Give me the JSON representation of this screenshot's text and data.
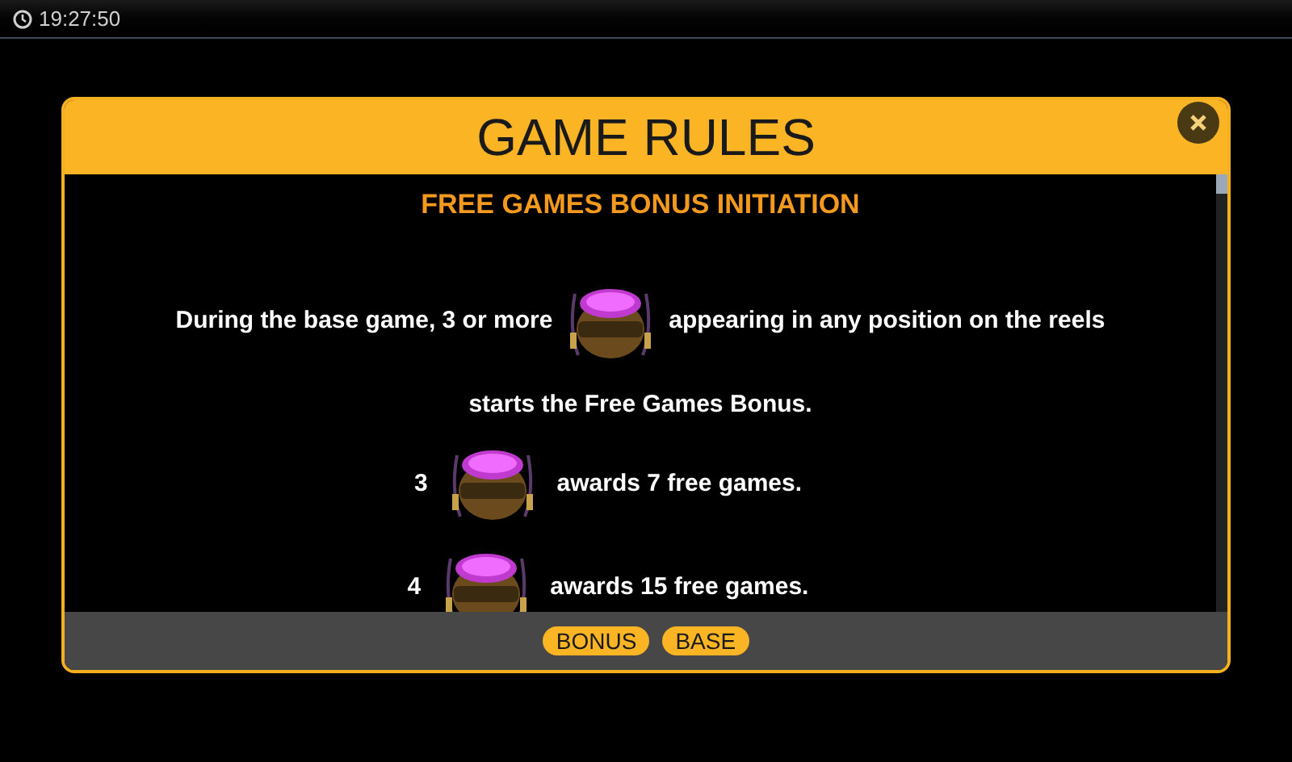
{
  "status_bar": {
    "time": "19:27:50"
  },
  "dialog": {
    "title": "GAME RULES",
    "heading": "FREE GAMES BONUS INITIATION",
    "intro": {
      "before": "During the base game, 3 or more",
      "after": "appearing in any position on the reels",
      "second_line": "starts the Free Games Bonus."
    },
    "awards": [
      {
        "count": "3",
        "text": "awards 7 free games."
      },
      {
        "count": "4",
        "text": "awards 15 free games."
      }
    ],
    "buttons": [
      "BONUS",
      "BASE"
    ]
  }
}
